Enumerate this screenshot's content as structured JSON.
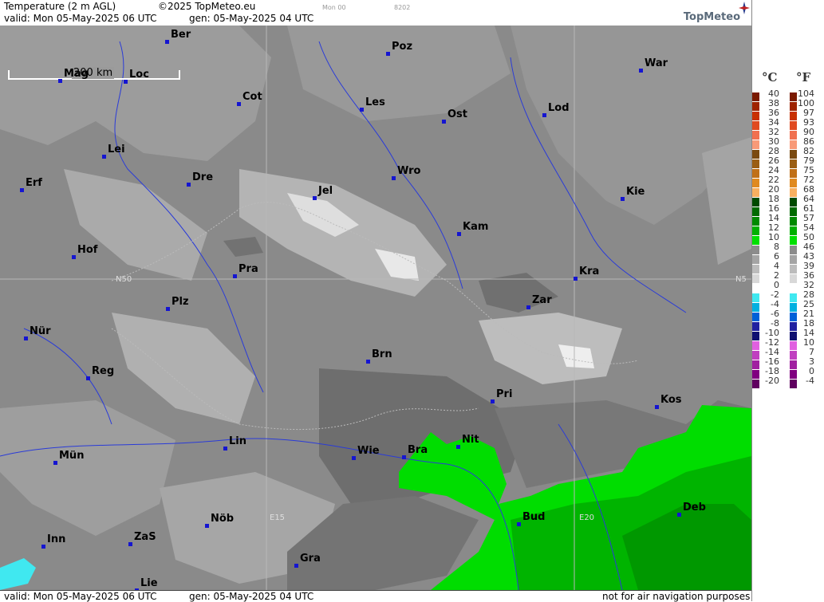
{
  "header": {
    "title": "Temperature (2 m AGL)",
    "copyright": "©2025 TopMeteo.eu",
    "run_code": "Mon 00",
    "code2": "8202",
    "valid": "valid:  Mon  05-May-2025  06 UTC",
    "gen": "gen:  05-May-2025  04 UTC",
    "brand": "TopMeteo"
  },
  "footer": {
    "valid": "valid:  Mon  05-May-2025  06 UTC",
    "gen": "gen:  05-May-2025  04 UTC",
    "disclaimer": "not for air navigation purposes"
  },
  "map": {
    "scale_label": "200 km",
    "grid_labels": [
      "N50",
      "N5",
      "E15",
      "E20"
    ],
    "cities": [
      "Ber",
      "Poz",
      "War",
      "Mag",
      "Loc",
      "Cot",
      "Les",
      "Ost",
      "Lod",
      "Lei",
      "Erf",
      "Dre",
      "Wro",
      "Jel",
      "Kie",
      "Hof",
      "Kam",
      "Pra",
      "Kra",
      "Zar",
      "Plz",
      "Nür",
      "Brn",
      "Reg",
      "Pri",
      "Kos",
      "Lin",
      "Nit",
      "Wie",
      "Bra",
      "Mün",
      "Bud",
      "Deb",
      "Nöb",
      "Inn",
      "ZaS",
      "Gra",
      "Lie"
    ]
  },
  "legend": {
    "unit_c": "°C",
    "unit_f": "°F",
    "celsius": [
      "40",
      "38",
      "36",
      "34",
      "32",
      "30",
      "28",
      "26",
      "24",
      "22",
      "20",
      "18",
      "16",
      "14",
      "12",
      "10",
      "8",
      "6",
      "4",
      "2",
      "0",
      "-2",
      "-4",
      "-6",
      "-8",
      "-10",
      "-12",
      "-14",
      "-16",
      "-18",
      "-20"
    ],
    "fahrenheit": [
      "104",
      "100",
      "97",
      "93",
      "90",
      "86",
      "82",
      "79",
      "75",
      "72",
      "68",
      "64",
      "61",
      "57",
      "54",
      "50",
      "46",
      "43",
      "39",
      "36",
      "32",
      "28",
      "25",
      "21",
      "18",
      "14",
      "10",
      "7",
      "3",
      "0",
      "-4"
    ],
    "colors": [
      "#7a1a00",
      "#9e2200",
      "#c83000",
      "#e04a20",
      "#f07050",
      "#f89a78",
      "#7a4a10",
      "#9a5e14",
      "#c07018",
      "#e08a20",
      "#f8b060",
      "#004a00",
      "#006a00",
      "#008a00",
      "#00b000",
      "#00e000",
      "#8c8c8c",
      "#a4a4a4",
      "#bcbcbc",
      "#d8d8d8",
      "#ffffff",
      "#40e8f0",
      "#00b0e0",
      "#0060d8",
      "#2020a0",
      "#101070",
      "#e060e0",
      "#c040c0",
      "#a020a0",
      "#800080",
      "#600060"
    ]
  }
}
